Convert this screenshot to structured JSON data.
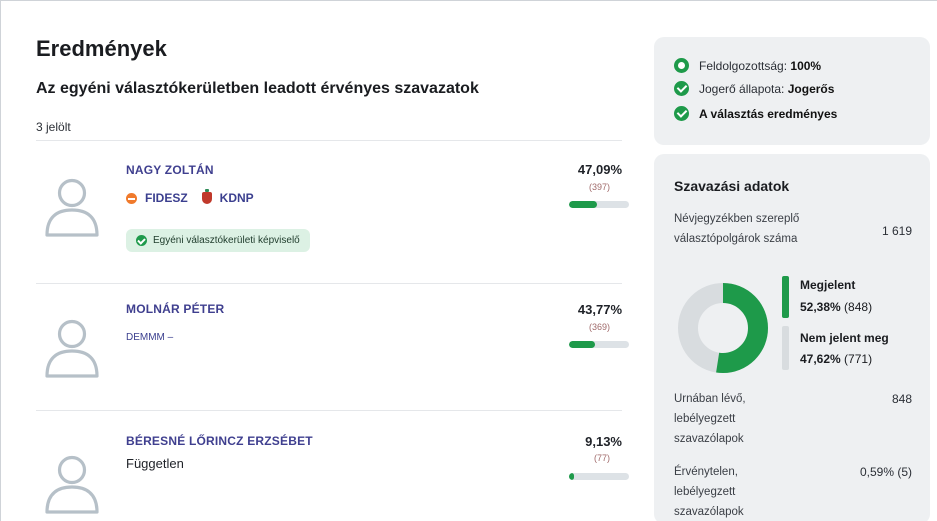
{
  "results": {
    "title": "Eredmények",
    "subtitle": "Az egyéni választókerületben leadott érvényes szavazatok",
    "candidate_count": "3 jelölt",
    "candidates": [
      {
        "name": "NAGY ZOLTÁN",
        "parties": [
          "FIDESZ",
          "KDNP"
        ],
        "badge": "Egyéni választókerületi képviselő",
        "percent": "47,09%",
        "votes": "(397)",
        "share": 0.4709
      },
      {
        "name": "MOLNÁR PÉTER",
        "party_text": "DEMMM –",
        "percent": "43,77%",
        "votes": "(369)",
        "share": 0.4377
      },
      {
        "name": "BÉRESNÉ LŐRINCZ ERZSÉBET",
        "party_text": "Független",
        "percent": "9,13%",
        "votes": "(77)",
        "share": 0.0913
      }
    ]
  },
  "status": {
    "processing_label": "Feldolgozottság:",
    "processing_value": "100%",
    "legal_label": "Jogerő állapota:",
    "legal_value": "Jogerős",
    "valid_text": "A választás eredményes"
  },
  "voting": {
    "title": "Szavazási adatok",
    "registered_label": "Névjegyzékben szereplő választópolgárok száma",
    "registered_value": "1 619",
    "appeared_label": "Megjelent",
    "appeared_pct": "52,38%",
    "appeared_count": "(848)",
    "appeared_share": 0.5238,
    "not_appeared_label": "Nem jelent meg",
    "not_appeared_pct": "47,62%",
    "not_appeared_count": "(771)",
    "ballots_label": "Urnában lévő, lebélyegzett szavazólapok",
    "ballots_value": "848",
    "invalid_label": "Érvénytelen, lebélyegzett szavazólapok",
    "invalid_value": "0,59% (5)"
  },
  "colors": {
    "accent_green": "#1e9a4a",
    "bar_track": "#dde2e6",
    "candidate_name": "#3f3f8f",
    "panel_bg": "#eef0f2"
  },
  "icons": {
    "processing": "ring-icon",
    "legal": "check-circle-icon",
    "valid": "check-circle-icon",
    "candidate": "person-avatar-icon"
  }
}
